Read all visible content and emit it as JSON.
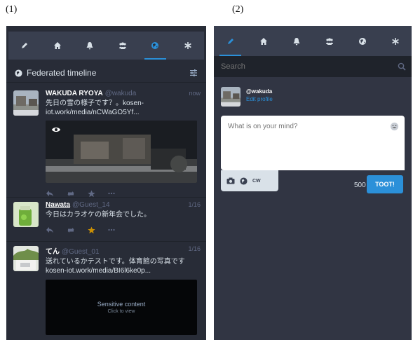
{
  "captions": [
    "(1)",
    "(2)"
  ],
  "panel1": {
    "tabs": [
      {
        "icon": "pencil-icon"
      },
      {
        "icon": "home-icon"
      },
      {
        "icon": "bell-icon"
      },
      {
        "icon": "users-icon"
      },
      {
        "icon": "globe-icon",
        "active": true
      },
      {
        "icon": "asterisk-icon"
      }
    ],
    "column_title": "Federated timeline",
    "statuses": [
      {
        "name": "WAKUDA RYOYA",
        "handle": "@wakuda",
        "time": "now",
        "text": "先日の雪の様子です？。kosen-iot.work/media/nCWaGO5Yf..."
      },
      {
        "name": "Nawata",
        "handle": "@Guest_14",
        "time": "1/16",
        "text": "今日はカラオケの新年会でした。"
      },
      {
        "name": "てん",
        "handle": "@Guest_01",
        "time": "1/16",
        "text": "送れているかテストです。体育館の写真です kosen-iot.work/media/BI6l6ke0p...",
        "sensitive_title": "Sensitive content",
        "sensitive_sub": "Click to view"
      }
    ]
  },
  "panel2": {
    "tabs": [
      {
        "icon": "pencil-icon",
        "active": true
      },
      {
        "icon": "home-icon"
      },
      {
        "icon": "bell-icon"
      },
      {
        "icon": "users-icon"
      },
      {
        "icon": "globe-icon"
      },
      {
        "icon": "asterisk-icon"
      }
    ],
    "search_placeholder": "Search",
    "account_handle": "@wakuda",
    "edit_profile": "Edit profile",
    "compose_placeholder": "What is on your mind?",
    "cw_label": "CW",
    "char_counter": "500",
    "toot_label": "TOOT!"
  },
  "colors": {
    "accent": "#2b90d9",
    "favourite": "#ca8f04",
    "icon_gray": "#606984"
  }
}
